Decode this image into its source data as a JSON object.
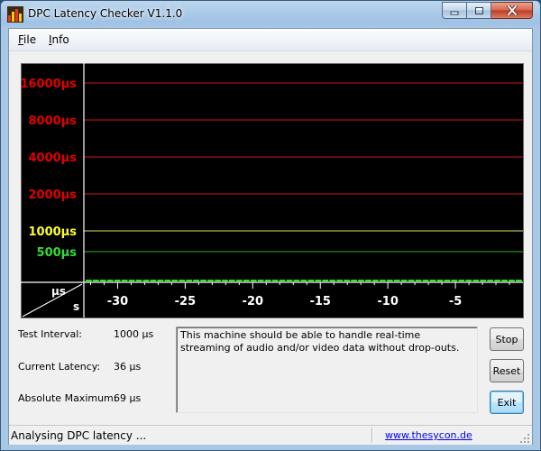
{
  "window": {
    "title": "DPC Latency Checker V1.1.0",
    "controls": {
      "minimize": "minimize",
      "maximize": "maximize",
      "close": "close"
    }
  },
  "menu": {
    "file": {
      "accel": "F",
      "rest": "ile"
    },
    "info": {
      "accel": "I",
      "rest": "nfo"
    }
  },
  "chart_data": {
    "type": "bar",
    "title": "",
    "xlabel": "s",
    "ylabel": "µs",
    "x_ticks": [
      "-30",
      "-25",
      "-20",
      "-15",
      "-10",
      "-5"
    ],
    "x_tick_values": [
      -30,
      -25,
      -20,
      -15,
      -10,
      -5
    ],
    "xlim": [
      -32.5,
      0
    ],
    "y_lines": [
      {
        "label": "16000µs",
        "value": 16000,
        "color": "#e10000"
      },
      {
        "label": "8000µs",
        "value": 8000,
        "color": "#e10000"
      },
      {
        "label": "4000µs",
        "value": 4000,
        "color": "#e10000"
      },
      {
        "label": "2000µs",
        "value": 2000,
        "color": "#e10000"
      },
      {
        "label": "1000µs",
        "value": 1000,
        "color": "#ffff2a"
      },
      {
        "label": "500µs",
        "value": 500,
        "color": "#33dd33"
      }
    ],
    "grid": true,
    "background": "#000000",
    "bar_color": "#22ee22",
    "values": [
      38,
      38,
      38,
      38,
      38,
      40,
      40,
      38,
      42,
      38,
      38,
      38,
      40,
      38,
      45,
      40,
      38,
      38,
      38,
      40,
      38,
      38,
      38,
      40,
      38,
      38,
      40,
      38,
      38,
      40,
      45,
      38,
      38,
      38,
      38,
      40,
      38,
      38,
      38,
      38,
      40,
      38,
      38,
      38,
      38,
      40,
      38,
      38,
      38,
      38,
      38,
      38,
      38,
      38,
      38,
      38,
      38,
      38,
      38,
      38,
      36
    ]
  },
  "stats": {
    "test_interval": {
      "label": "Test Interval:",
      "value": "1000 µs"
    },
    "current_latency": {
      "label": "Current Latency:",
      "value": "36 µs"
    },
    "absolute_maximum": {
      "label": "Absolute Maximum:",
      "value": "69 µs"
    }
  },
  "message": "This machine should be able to handle real-time streaming of audio and/or video data without drop-outs.",
  "buttons": {
    "stop": "Stop",
    "reset": "Reset",
    "exit": "Exit"
  },
  "status": {
    "text": "Analysing DPC latency ...",
    "link": "www.thesycon.de"
  }
}
